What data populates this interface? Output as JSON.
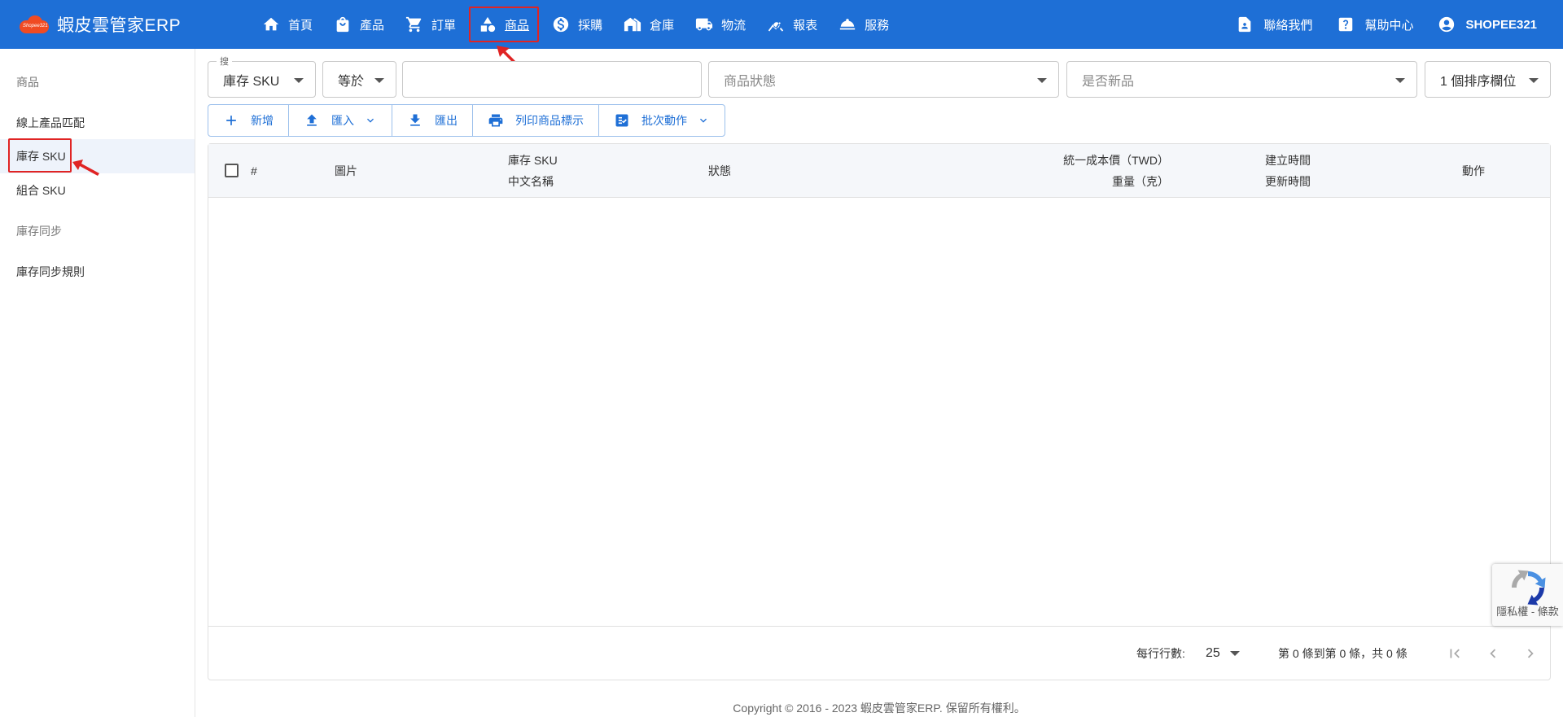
{
  "brand": {
    "name": "蝦皮雲管家ERP",
    "logo_text": "Shopee321"
  },
  "nav": [
    {
      "label": "首頁",
      "icon": "home-icon"
    },
    {
      "label": "產品",
      "icon": "shopping-bag-icon"
    },
    {
      "label": "訂單",
      "icon": "cart-icon"
    },
    {
      "label": "商品",
      "icon": "shapes-icon",
      "active": true
    },
    {
      "label": "採購",
      "icon": "dollar-icon"
    },
    {
      "label": "倉庫",
      "icon": "warehouse-icon"
    },
    {
      "label": "物流",
      "icon": "truck-icon"
    },
    {
      "label": "報表",
      "icon": "chart-search-icon"
    },
    {
      "label": "服務",
      "icon": "service-bell-icon"
    }
  ],
  "right_nav": {
    "contact": "聯絡我們",
    "help": "幫助中心",
    "user": "SHOPEE321"
  },
  "sidebar": {
    "header1": "商品",
    "items1": [
      "線上產品匹配",
      "庫存 SKU",
      "組合 SKU"
    ],
    "header2": "庫存同步",
    "items2": [
      "庫存同步規則"
    ]
  },
  "filters": {
    "search_legend": "搜",
    "field_select": "庫存 SKU",
    "operator_select": "等於",
    "search_value": "",
    "status_placeholder": "商品狀態",
    "new_placeholder": "是否新品",
    "sort_select": "1 個排序欄位"
  },
  "toolbar": {
    "add": "新增",
    "import": "匯入",
    "export": "匯出",
    "print": "列印商品標示",
    "batch": "批次動作"
  },
  "table": {
    "col_index": "#",
    "col_image": "圖片",
    "col_sku": "庫存 SKU",
    "col_name": "中文名稱",
    "col_status": "狀態",
    "col_cost": "統一成本價（TWD）",
    "col_weight": "重量（克）",
    "col_created": "建立時間",
    "col_updated": "更新時間",
    "col_action": "動作"
  },
  "pagination": {
    "rows_label": "每行行數:",
    "rows_value": "25",
    "range_text": "第 0 條到第 0 條，共 0 條"
  },
  "copyright": "Copyright © 2016 - 2023 蝦皮雲管家ERP. 保留所有權利。",
  "recaptcha": {
    "text": "隱私權 - 條款"
  },
  "colors": {
    "primary": "#1e6fd6",
    "highlight": "#e02424",
    "logo": "#f04b23"
  }
}
